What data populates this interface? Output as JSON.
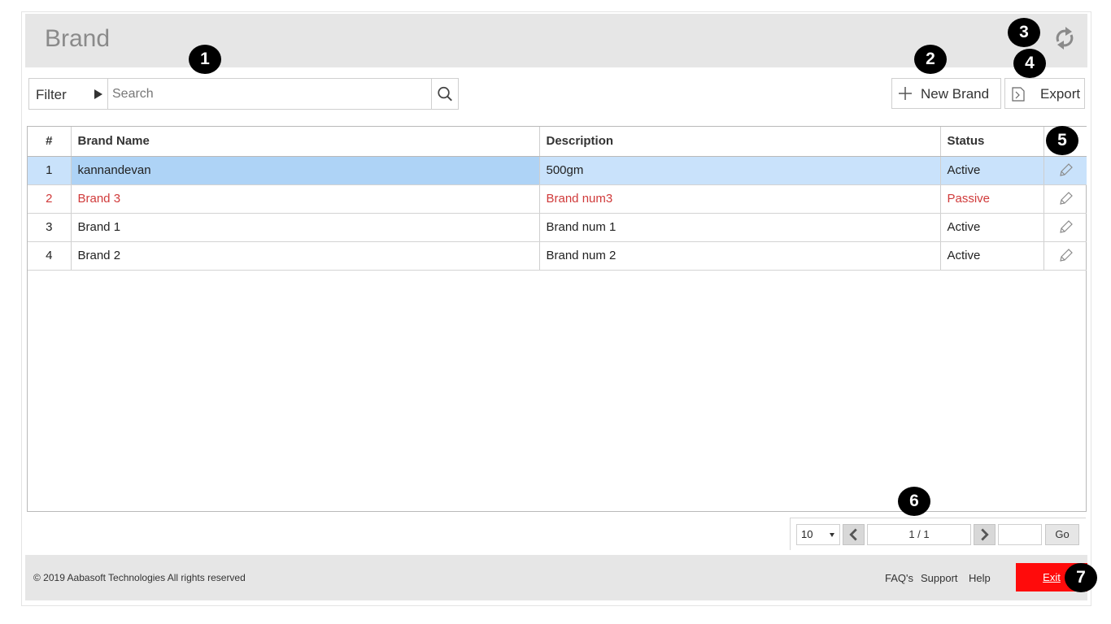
{
  "header": {
    "title": "Brand"
  },
  "toolbar": {
    "filter_label": "Filter",
    "search_placeholder": "Search",
    "new_label": "New Brand",
    "export_label": "Export"
  },
  "table": {
    "columns": [
      "#",
      "Brand Name",
      "Description",
      "Status"
    ],
    "rows": [
      {
        "num": "1",
        "name": "kannandevan",
        "description": "500gm",
        "status": "Active"
      },
      {
        "num": "2",
        "name": "Brand 3",
        "description": "Brand num3",
        "status": "Passive"
      },
      {
        "num": "3",
        "name": "Brand 1",
        "description": "Brand num 1",
        "status": "Active"
      },
      {
        "num": "4",
        "name": "Brand 2",
        "description": "Brand num 2",
        "status": "Active"
      }
    ]
  },
  "pager": {
    "page_size": "10",
    "page_info": "1 / 1",
    "go_label": "Go"
  },
  "footer": {
    "copyright": "© 2019 Aabasoft Technologies All rights reserved",
    "faq": "FAQ's",
    "support": "Support",
    "help": "Help",
    "exit": "Exit"
  },
  "markers": [
    "1",
    "2",
    "3",
    "4",
    "5",
    "6",
    "7"
  ],
  "colors": {
    "accent_exit": "#ff0b0b",
    "passive_text": "#d03a3a",
    "selected_row": "#c9e2fb",
    "header_bg": "#e6e6e6"
  },
  "icons": [
    "refresh-icon",
    "search-icon",
    "plus-icon",
    "export-icon",
    "edit-icon",
    "chevron-left-icon",
    "chevron-right-icon"
  ]
}
